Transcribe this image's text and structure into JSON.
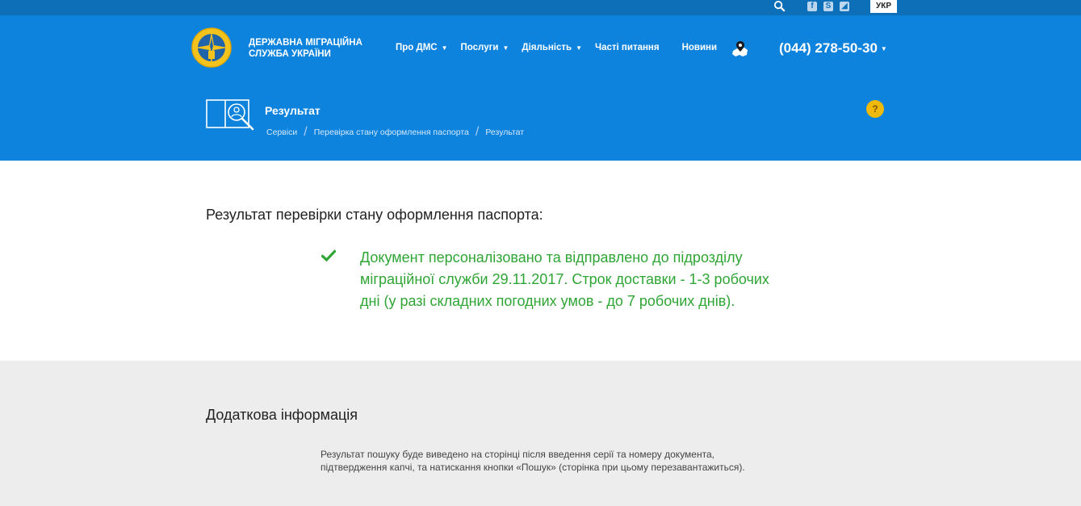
{
  "topbar": {
    "search_icon": "search-icon",
    "social": [
      {
        "name": "facebook-icon",
        "glyph": "f"
      },
      {
        "name": "skype-icon",
        "glyph": "S"
      },
      {
        "name": "rss-icon",
        "glyph": "◢"
      }
    ],
    "language": "УКР"
  },
  "header": {
    "org_name_line1": "ДЕРЖАВНА МІГРАЦІЙНА",
    "org_name_line2": "СЛУЖБА УКРАЇНИ",
    "nav": [
      {
        "label": "Про ДМС",
        "has_dropdown": true
      },
      {
        "label": "Послуги",
        "has_dropdown": true
      },
      {
        "label": "Діяльність",
        "has_dropdown": true
      },
      {
        "label": "Часті питання",
        "has_dropdown": false
      },
      {
        "label": "Новини",
        "has_dropdown": false
      }
    ],
    "phone": "(044) 278-50-30",
    "page_title": "Результат",
    "breadcrumb": [
      "Сервіси",
      "Перевірка стану оформлення паспорта",
      "Результат"
    ],
    "help": "?"
  },
  "result": {
    "heading": "Результат перевірки стану оформлення паспорта:",
    "message": "Документ персоналізовано та відправлено до підрозділу міграційної служби 29.11.2017. Строк доставки - 1-3 робочих дні (у разі складних погодних умов - до 7 робочих днів)."
  },
  "info": {
    "heading": "Додаткова інформація",
    "text": "Результат пошуку буде виведено на сторінці після введення серії та номеру документа, підтвердження капчі, та натискання кнопки «Пошук» (сторінка при цьому перезавантажиться)."
  },
  "colors": {
    "topbar": "#0d6fb8",
    "header": "#0d83de",
    "success": "#2fa535",
    "help": "#f0b90b",
    "info_bg": "#ededed",
    "warning": "#e5392b"
  }
}
